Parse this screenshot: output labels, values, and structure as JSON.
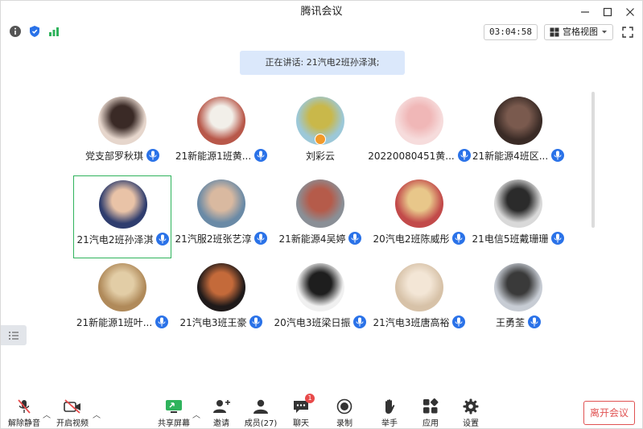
{
  "window": {
    "title": "腾讯会议"
  },
  "toolbar": {
    "timer": "03:04:58",
    "view_label": "宫格视图"
  },
  "speaking": {
    "text": "正在讲话: 21汽电2班孙泽淇;"
  },
  "participants": [
    {
      "name": "党支部罗秋琪",
      "avatar_color": "#e6d6cc",
      "avatar_accent": "#3a2a26"
    },
    {
      "name": "21新能源1班黄...",
      "avatar_color": "#b8584a",
      "avatar_accent": "#f2efe9"
    },
    {
      "name": "刘彩云",
      "avatar_color": "#9cc8d8",
      "avatar_accent": "#c9b84a"
    },
    {
      "name": "20220080451黄...",
      "avatar_color": "#f6dcdc",
      "avatar_accent": "#f0b7b7"
    },
    {
      "name": "21新能源4班区...",
      "avatar_color": "#3a2b26",
      "avatar_accent": "#7a5a4e"
    },
    {
      "name": "21汽电2班孙泽淇",
      "avatar_color": "#2f3d6e",
      "avatar_accent": "#e9c3a7"
    },
    {
      "name": "21汽服2班张艺淳",
      "avatar_color": "#6a8aa6",
      "avatar_accent": "#d9b9a0"
    },
    {
      "name": "21新能源4吴婷",
      "avatar_color": "#8a8f96",
      "avatar_accent": "#b55b4a"
    },
    {
      "name": "20汽电2班陈威彤",
      "avatar_color": "#c24a4a",
      "avatar_accent": "#e8c78a"
    },
    {
      "name": "21电信5班戴珊珊",
      "avatar_color": "#d9d9d9",
      "avatar_accent": "#2b2b2b"
    },
    {
      "name": "21新能源1班叶...",
      "avatar_color": "#b08a5a",
      "avatar_accent": "#e2cda6"
    },
    {
      "name": "21汽电3班王豪",
      "avatar_color": "#1f1a1a",
      "avatar_accent": "#c46a3a"
    },
    {
      "name": "20汽电3班梁日振",
      "avatar_color": "#f0f0f0",
      "avatar_accent": "#1e1e1e"
    },
    {
      "name": "21汽电3班唐高裕",
      "avatar_color": "#d7c2a8",
      "avatar_accent": "#f3e6d6"
    },
    {
      "name": "王勇荃",
      "avatar_color": "#c7ccd4",
      "avatar_accent": "#3a3a3a"
    }
  ],
  "bottom": {
    "unmute": "解除静音",
    "video": "开启视频",
    "share": "共享屏幕",
    "invite": "邀请",
    "members": "成员(27)",
    "chat": "聊天",
    "chat_badge": "1",
    "record": "录制",
    "raise_hand": "举手",
    "apps": "应用",
    "settings": "设置",
    "leave": "离开会议"
  },
  "colors": {
    "accent": "#2a72e8",
    "active_border": "#2fb35c",
    "leave": "#e05252",
    "speaking_bg": "#dbe8fb"
  }
}
